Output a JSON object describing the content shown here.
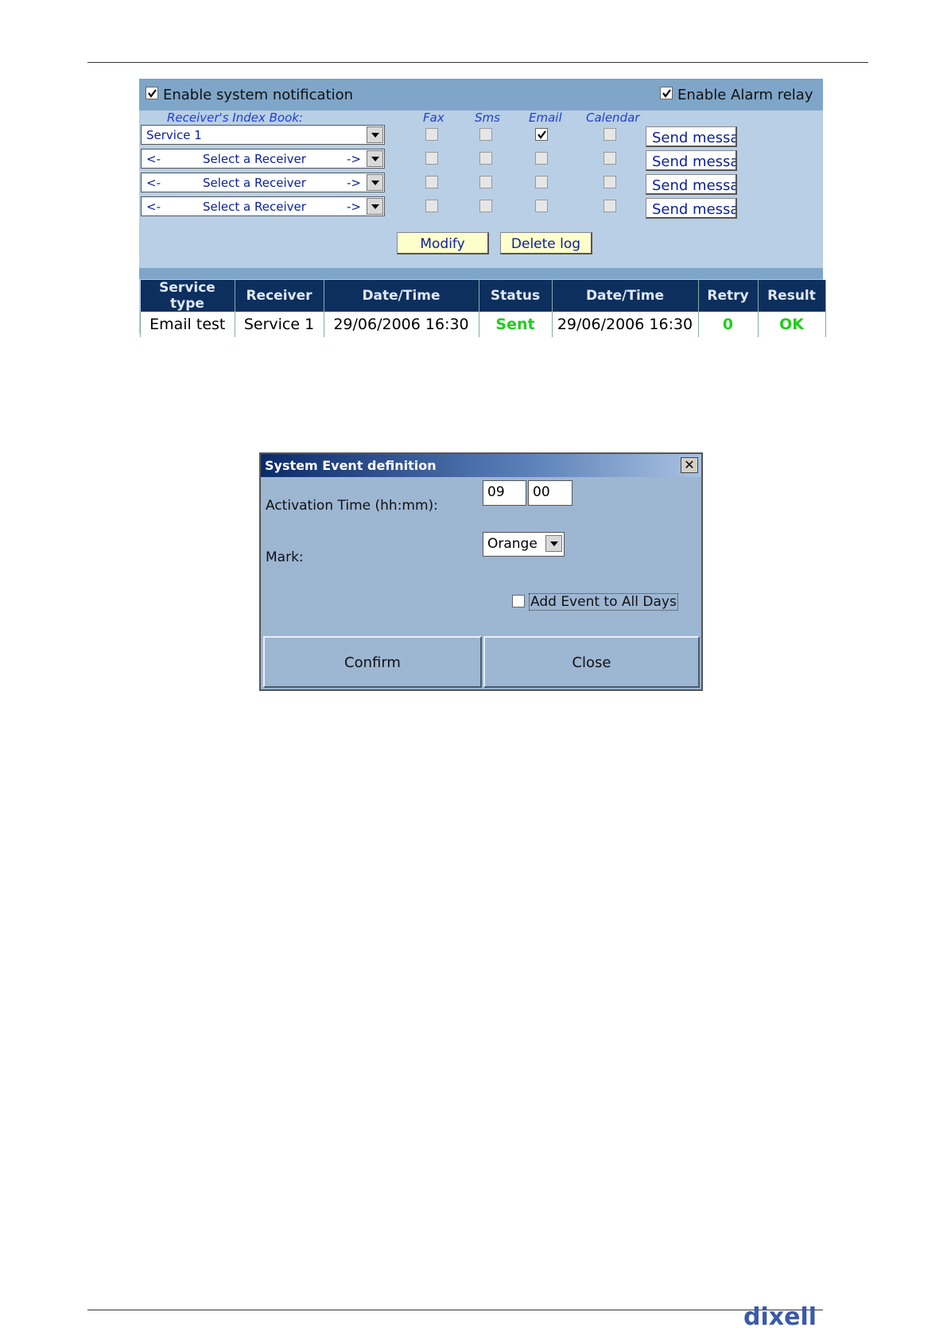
{
  "notification": {
    "enable_system_label": "Enable system notification",
    "enable_system_checked": true,
    "enable_alarm_label": "Enable Alarm relay",
    "enable_alarm_checked": true,
    "index_book_label": "Receiver's Index Book:",
    "col_fax": "Fax",
    "col_sms": "Sms",
    "col_email": "Email",
    "col_calendar": "Calendar",
    "rows": [
      {
        "left": "Service 1",
        "mid": "",
        "right": "",
        "fax": false,
        "sms": false,
        "email": true,
        "calendar": false,
        "send": "Send message"
      },
      {
        "left": "<-",
        "mid": "Select a Receiver",
        "right": "->",
        "fax": false,
        "sms": false,
        "email": false,
        "calendar": false,
        "send": "Send message"
      },
      {
        "left": "<-",
        "mid": "Select a Receiver",
        "right": "->",
        "fax": false,
        "sms": false,
        "email": false,
        "calendar": false,
        "send": "Send message"
      },
      {
        "left": "<-",
        "mid": "Select a Receiver",
        "right": "->",
        "fax": false,
        "sms": false,
        "email": false,
        "calendar": false,
        "send": "Send message"
      }
    ],
    "modify_label": "Modify",
    "delete_log_label": "Delete log"
  },
  "log_table": {
    "headers": [
      "Service type",
      "Receiver",
      "Date/Time",
      "Status",
      "Date/Time",
      "Retry",
      "Result"
    ],
    "row": [
      "Email test",
      "Service 1",
      "29/06/2006 16:30",
      "Sent",
      "29/06/2006 16:30",
      "0",
      "OK"
    ]
  },
  "dialog": {
    "title": "System Event definition",
    "close_symbol": "✕",
    "activation_label": "Activation Time (hh:mm):",
    "hour": "09",
    "minute": "00",
    "mark_label": "Mark:",
    "mark_value": "Orange",
    "add_all_days_label": "Add Event to All Days",
    "add_all_days_checked": false,
    "confirm_label": "Confirm",
    "close_label": "Close"
  },
  "footer": {
    "logo_text": "dixell"
  },
  "colors": {
    "panel_bg": "#b8cfe6",
    "header_band": "#7fa6c9",
    "table_header": "#0d2f5e",
    "status_green": "#22cc22"
  }
}
